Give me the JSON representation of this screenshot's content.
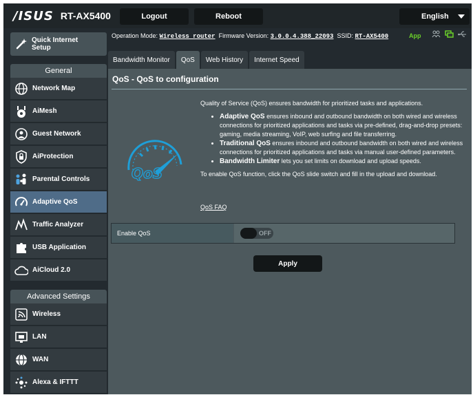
{
  "header": {
    "logo_text": "/ISUS",
    "model": "RT-AX5400",
    "logout_label": "Logout",
    "reboot_label": "Reboot",
    "language": "English"
  },
  "status_bar": {
    "operation_mode_label": "Operation Mode:",
    "operation_mode_value": "Wireless router",
    "firmware_label": "Firmware Version:",
    "firmware_value": "3.0.0.4.388_22093",
    "ssid_label": "SSID:",
    "ssid_value": "RT-AX5400",
    "app_label": "App",
    "icons": [
      "users-icon",
      "network-status-icon",
      "usb-icon"
    ]
  },
  "sidebar": {
    "quick_setup": {
      "label_line1": "Quick Internet",
      "label_line2": "Setup",
      "icon": "magic-wand-icon"
    },
    "general_header": "General",
    "general_items": [
      {
        "label": "Network Map",
        "icon": "globe-icon"
      },
      {
        "label": "AiMesh",
        "icon": "aimesh-icon"
      },
      {
        "label": "Guest Network",
        "icon": "guest-globe-icon"
      },
      {
        "label": "AiProtection",
        "icon": "lock-shield-icon"
      },
      {
        "label": "Parental Controls",
        "icon": "family-icon"
      },
      {
        "label": "Adaptive QoS",
        "icon": "speedometer-icon",
        "active": true
      },
      {
        "label": "Traffic Analyzer",
        "icon": "traffic-icon"
      },
      {
        "label": "USB Application",
        "icon": "puzzle-icon"
      },
      {
        "label": "AiCloud 2.0",
        "icon": "cloud-icon"
      }
    ],
    "advanced_header": "Advanced Settings",
    "advanced_items": [
      {
        "label": "Wireless",
        "icon": "wifi-icon"
      },
      {
        "label": "LAN",
        "icon": "lan-icon"
      },
      {
        "label": "WAN",
        "icon": "wan-globe-icon"
      },
      {
        "label": "Alexa & IFTTT",
        "icon": "alexa-icon"
      }
    ]
  },
  "tabs": [
    {
      "label": "Bandwidth Monitor"
    },
    {
      "label": "QoS",
      "active": true
    },
    {
      "label": "Web History"
    },
    {
      "label": "Internet Speed"
    }
  ],
  "content": {
    "title": "QoS - QoS to configuration",
    "intro": "Quality of Service (QoS) ensures bandwidth for prioritized tasks and applications.",
    "bullets": [
      {
        "bold": "Adaptive QoS",
        "text": " ensures inbound and outbound bandwidth on both wired and wireless connections for prioritized applications and tasks via pre-defined, drag-and-drop presets: gaming, media streaming, VoIP, web surfing and file transferring."
      },
      {
        "bold": "Traditional QoS",
        "text": " ensures inbound and outbound bandwidth on both wired and wireless connections for prioritized applications and tasks via manual user-defined parameters."
      },
      {
        "bold": "Bandwidth Limiter",
        "text": " lets you set limits on download and upload speeds."
      }
    ],
    "enable_instruction": "To enable QoS function, click the QoS slide switch and fill in the upload and download.",
    "faq_link": "QoS FAQ",
    "logo_text": "QoS",
    "enable_label": "Enable QoS",
    "switch_state": "OFF",
    "apply_label": "Apply"
  },
  "colors": {
    "accent_active": "#4f6c88",
    "app_green": "#6bcf2a",
    "qos_logo_blue": "#1e9fd8"
  }
}
